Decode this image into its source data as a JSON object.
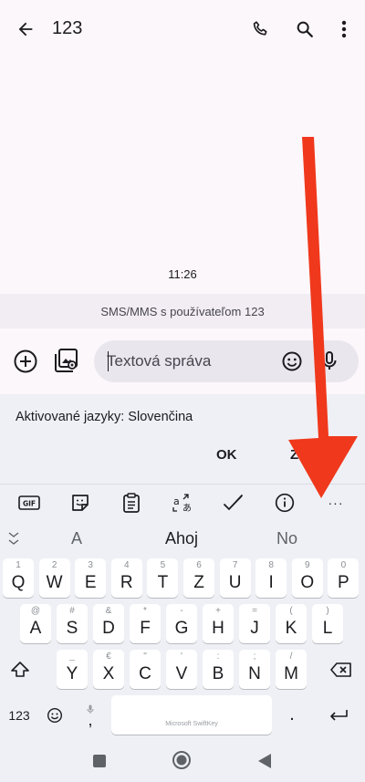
{
  "appbar": {
    "back_icon": "arrow-left-icon",
    "title": "123",
    "actions": [
      "phone-icon",
      "search-icon",
      "more-vert-icon"
    ]
  },
  "conversation": {
    "timestamp": "11:26",
    "info": "SMS/MMS s používateľom 123"
  },
  "compose": {
    "placeholder": "Textová správa",
    "icons": [
      "add-circle-icon",
      "gallery-icon",
      "emoji-icon",
      "mic-icon"
    ]
  },
  "language_panel": {
    "message": "Aktivované jazyky: Slovenčina",
    "ok_label": "OK",
    "change_label": "Zmeniť"
  },
  "keyboard": {
    "toolbar": [
      "GIF",
      "sticker-icon",
      "clipboard-icon",
      "translate-icon",
      "handwriting-icon",
      "info-icon",
      "···"
    ],
    "suggestions": [
      "A",
      "Ahoj",
      "No"
    ],
    "row1": [
      {
        "k": "Q",
        "a": "1"
      },
      {
        "k": "W",
        "a": "2"
      },
      {
        "k": "E",
        "a": "3"
      },
      {
        "k": "R",
        "a": "4"
      },
      {
        "k": "T",
        "a": "5"
      },
      {
        "k": "Z",
        "a": "6"
      },
      {
        "k": "U",
        "a": "7"
      },
      {
        "k": "I",
        "a": "8"
      },
      {
        "k": "O",
        "a": "9"
      },
      {
        "k": "P",
        "a": "0"
      }
    ],
    "row2": [
      {
        "k": "A",
        "a": "@"
      },
      {
        "k": "S",
        "a": "#"
      },
      {
        "k": "D",
        "a": "&"
      },
      {
        "k": "F",
        "a": "*"
      },
      {
        "k": "G",
        "a": "-"
      },
      {
        "k": "H",
        "a": "+"
      },
      {
        "k": "J",
        "a": "="
      },
      {
        "k": "K",
        "a": "("
      },
      {
        "k": "L",
        "a": ")"
      }
    ],
    "row3": [
      {
        "k": "Y",
        "a": "_"
      },
      {
        "k": "X",
        "a": "€"
      },
      {
        "k": "C",
        "a": "\""
      },
      {
        "k": "V",
        "a": "'"
      },
      {
        "k": "B",
        "a": ":"
      },
      {
        "k": "N",
        "a": ";"
      },
      {
        "k": "M",
        "a": "/"
      }
    ],
    "numbers_label": "123",
    "space_label": "Microsoft SwiftKey",
    "comma": ",",
    "period": "."
  },
  "colors": {
    "arrow": "#f0381c",
    "background": "#fcf7fb",
    "keyboard_bg": "#eef0f5"
  }
}
